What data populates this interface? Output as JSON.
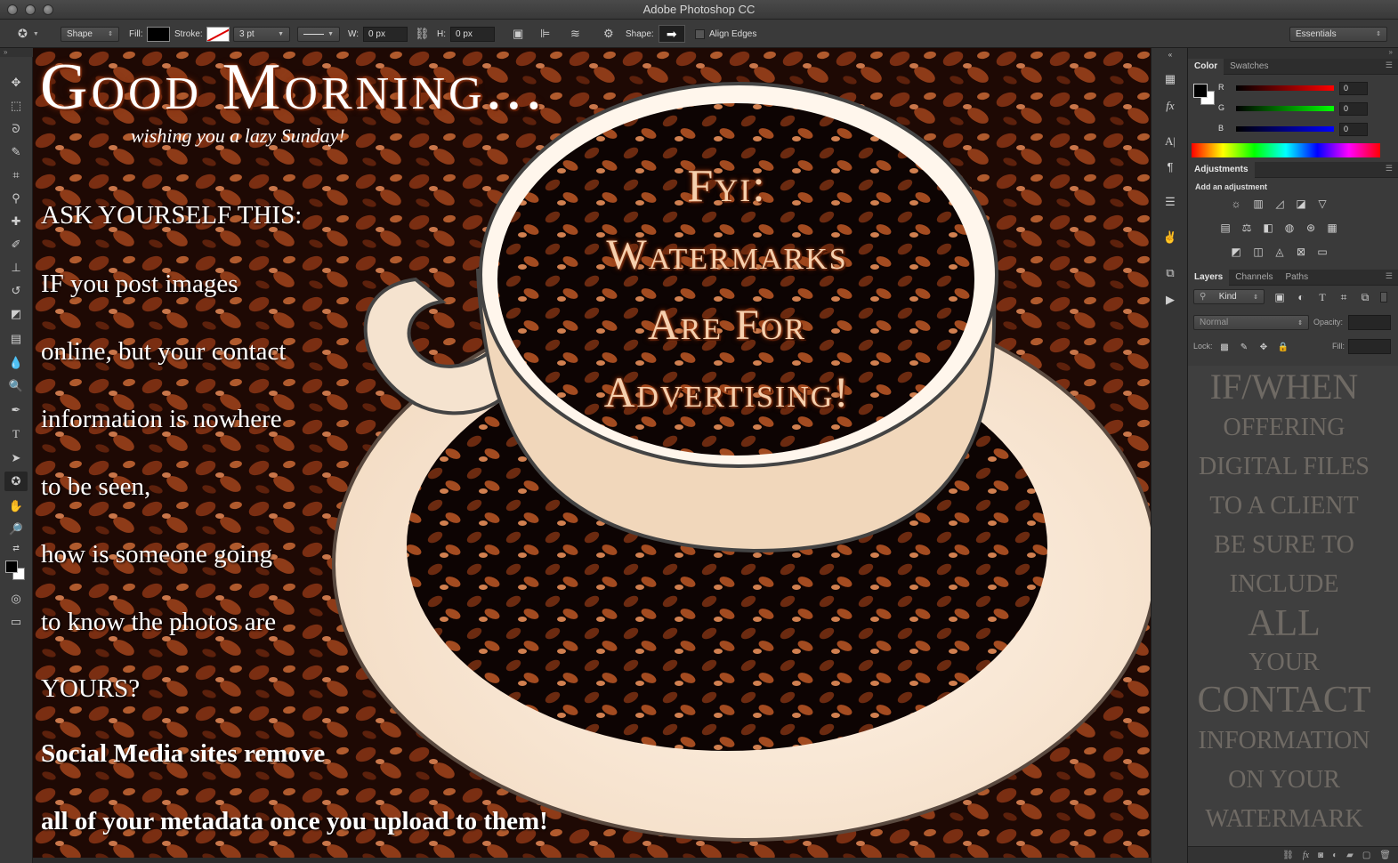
{
  "app": {
    "title": "Adobe Photoshop CC"
  },
  "options_bar": {
    "tool_mode": "Shape",
    "fill_label": "Fill:",
    "stroke_label": "Stroke:",
    "stroke_width": "3 pt",
    "width_label": "W:",
    "width_value": "0 px",
    "height_label": "H:",
    "height_value": "0 px",
    "shape_label": "Shape:",
    "align_edges_label": "Align Edges",
    "workspace": "Essentials"
  },
  "canvas": {
    "headline": "Good Morning...",
    "subline": "wishing you a lazy Sunday!",
    "lines": [
      "ASK YOURSELF THIS:",
      "IF you post images",
      "online, but your contact",
      "information is nowhere",
      "to be seen,",
      "how is someone going",
      "to know the photos are",
      "YOURS?"
    ],
    "bold_lines": [
      "Social Media sites remove",
      "all of your metadata once you upload to them!"
    ],
    "cup_text": [
      "Fyi:",
      "Watermarks",
      "Are For",
      "Advertising!"
    ]
  },
  "color_panel": {
    "tabs": [
      "Color",
      "Swatches"
    ],
    "channels": [
      {
        "label": "R",
        "value": "0"
      },
      {
        "label": "G",
        "value": "0"
      },
      {
        "label": "B",
        "value": "0"
      }
    ]
  },
  "adjustments_panel": {
    "tab": "Adjustments",
    "heading": "Add an adjustment"
  },
  "layers_panel": {
    "tabs": [
      "Layers",
      "Channels",
      "Paths"
    ],
    "filter_kind": "Kind",
    "blend_mode": "Normal",
    "opacity_label": "Opacity:",
    "lock_label": "Lock:",
    "fill_label": "Fill:",
    "preview_lines": [
      "IF/WHEN",
      "OFFERING",
      "DIGITAL FILES",
      "TO A CLIENT",
      "BE SURE TO",
      "INCLUDE",
      "ALL",
      "YOUR",
      "CONTACT",
      "INFORMATION",
      "ON YOUR",
      "WATERMARK"
    ]
  }
}
